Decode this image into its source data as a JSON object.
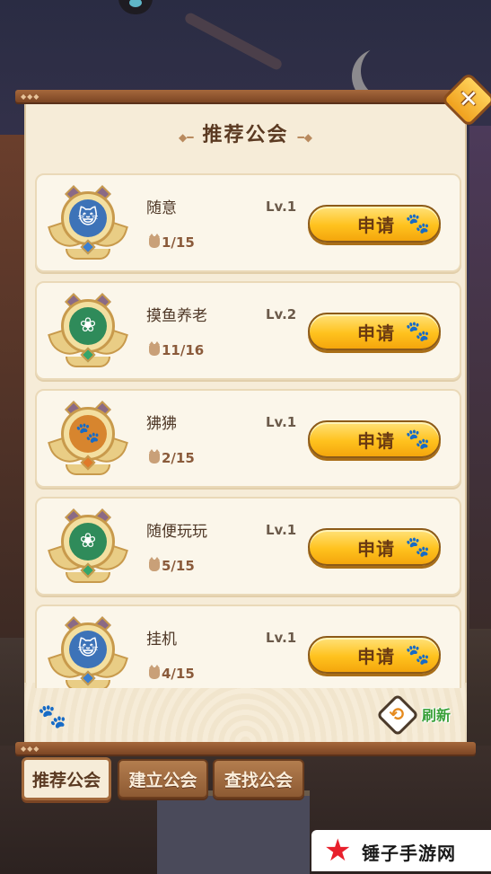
{
  "panel": {
    "title": "推荐公会",
    "close_icon": "close-x-icon"
  },
  "guilds": [
    {
      "name": "随意",
      "level": "Lv.1",
      "members": "1/15",
      "emblem": "cat-face-blue",
      "emblem_color": "#3d73b8",
      "gem_color": "#3a7fd0",
      "apply_label": "申请"
    },
    {
      "name": "摸鱼养老",
      "level": "Lv.2",
      "members": "11/16",
      "emblem": "leaf-green",
      "emblem_color": "#2f8b5a",
      "gem_color": "#34a56a",
      "apply_label": "申请"
    },
    {
      "name": "狒狒",
      "level": "Lv.1",
      "members": "2/15",
      "emblem": "paw-orange",
      "emblem_color": "#d7852e",
      "gem_color": "#e07a2a",
      "apply_label": "申请"
    },
    {
      "name": "随便玩玩",
      "level": "Lv.1",
      "members": "5/15",
      "emblem": "leaf-green",
      "emblem_color": "#2f8b5a",
      "gem_color": "#34a56a",
      "apply_label": "申请"
    },
    {
      "name": "挂机",
      "level": "Lv.1",
      "members": "4/15",
      "emblem": "cat-face-blue",
      "emblem_color": "#3d73b8",
      "gem_color": "#3a7fd0",
      "apply_label": "申请"
    }
  ],
  "refresh": {
    "label": "刷新",
    "icon": "refresh-icon"
  },
  "tabs": [
    {
      "label": "推荐公会",
      "active": true
    },
    {
      "label": "建立公会",
      "active": false
    },
    {
      "label": "查找公会",
      "active": false
    }
  ],
  "watermark": {
    "text": "锤子手游网"
  }
}
